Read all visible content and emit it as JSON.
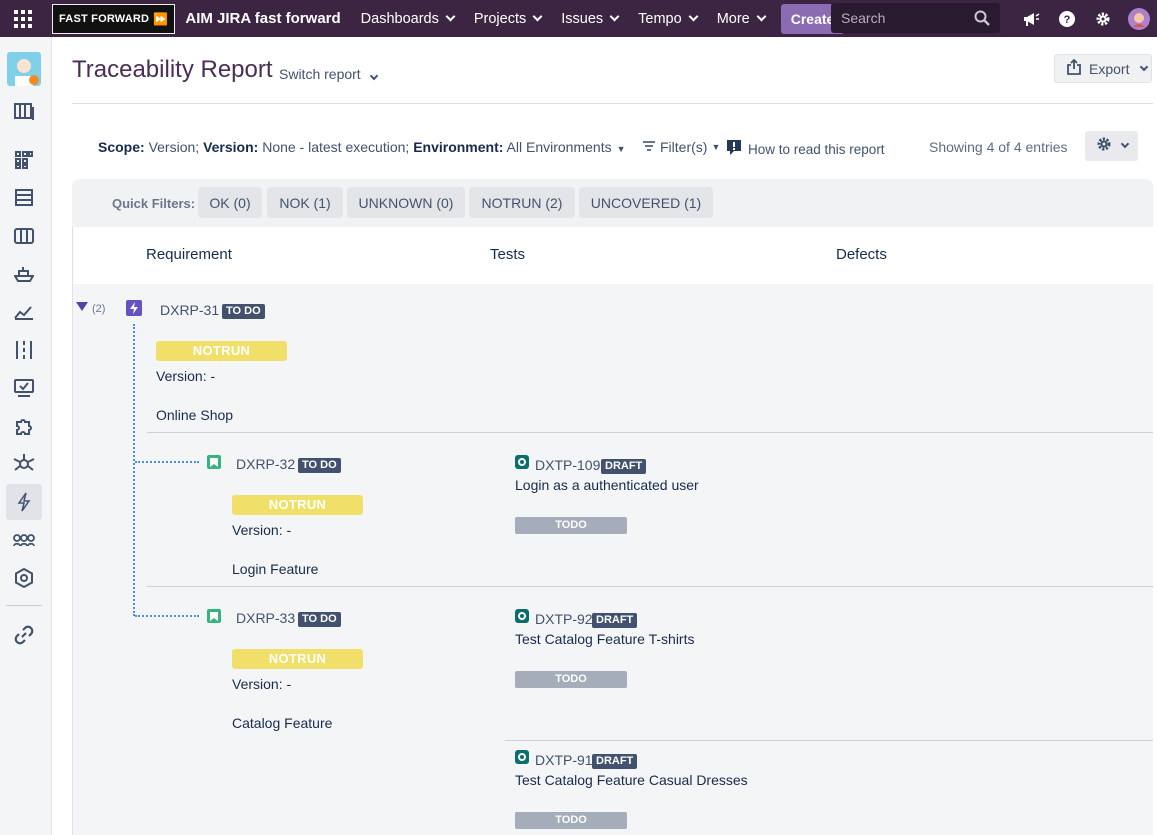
{
  "topnav": {
    "logo_text": "FAST FORWARD",
    "site_title": "AIM JIRA fast forward",
    "items": [
      {
        "label": "Dashboards"
      },
      {
        "label": "Projects"
      },
      {
        "label": "Issues"
      },
      {
        "label": "Tempo"
      },
      {
        "label": "More"
      }
    ],
    "create_label": "Create",
    "search_placeholder": "Search"
  },
  "page": {
    "title": "Traceability Report",
    "switch_report": "Switch report",
    "export_label": "Export"
  },
  "info": {
    "scope_key": "Scope:",
    "scope_val": "Version;",
    "version_key": "Version:",
    "version_val": "None - latest execution;",
    "env_key": "Environment:",
    "env_val": "All Environments",
    "filters": "Filter(s)",
    "howto": "How to read this report",
    "showing": "Showing 4 of 4 entries"
  },
  "quick_filters": {
    "label": "Quick Filters:",
    "buttons": [
      {
        "label": "OK (0)"
      },
      {
        "label": "NOK (1)"
      },
      {
        "label": "UNKNOWN (0)"
      },
      {
        "label": "NOTRUN (2)"
      },
      {
        "label": "UNCOVERED (1)"
      }
    ]
  },
  "table": {
    "headers": {
      "requirement": "Requirement",
      "tests": "Tests",
      "defects": "Defects"
    },
    "expand_count": "(2)",
    "parent": {
      "key": "DXRP-31",
      "status": "TO DO",
      "result": "NOTRUN",
      "version": "Version: -",
      "component": "Online Shop"
    },
    "children": [
      {
        "key": "DXRP-32",
        "status": "TO DO",
        "result": "NOTRUN",
        "version": "Version: -",
        "component": "Login Feature",
        "tests": [
          {
            "key": "DXTP-109",
            "status": "DRAFT",
            "summary": "Login as a authenticated user",
            "exec": "TODO"
          }
        ]
      },
      {
        "key": "DXRP-33",
        "status": "TO DO",
        "result": "NOTRUN",
        "version": "Version: -",
        "component": "Catalog Feature",
        "tests": [
          {
            "key": "DXTP-92",
            "status": "DRAFT",
            "summary": "Test Catalog Feature T-shirts",
            "exec": "TODO"
          },
          {
            "key": "DXTP-91",
            "status": "DRAFT",
            "summary": "Test Catalog Feature Casual Dresses",
            "exec": "TODO"
          }
        ]
      }
    ]
  },
  "colors": {
    "nav_bg": "#3c2542",
    "create_bg": "#8b6bb1",
    "notrun": "#f0e06a",
    "status_badge": "#42526e",
    "todo_bar": "#a5adba",
    "link_line": "#4a90e2"
  }
}
